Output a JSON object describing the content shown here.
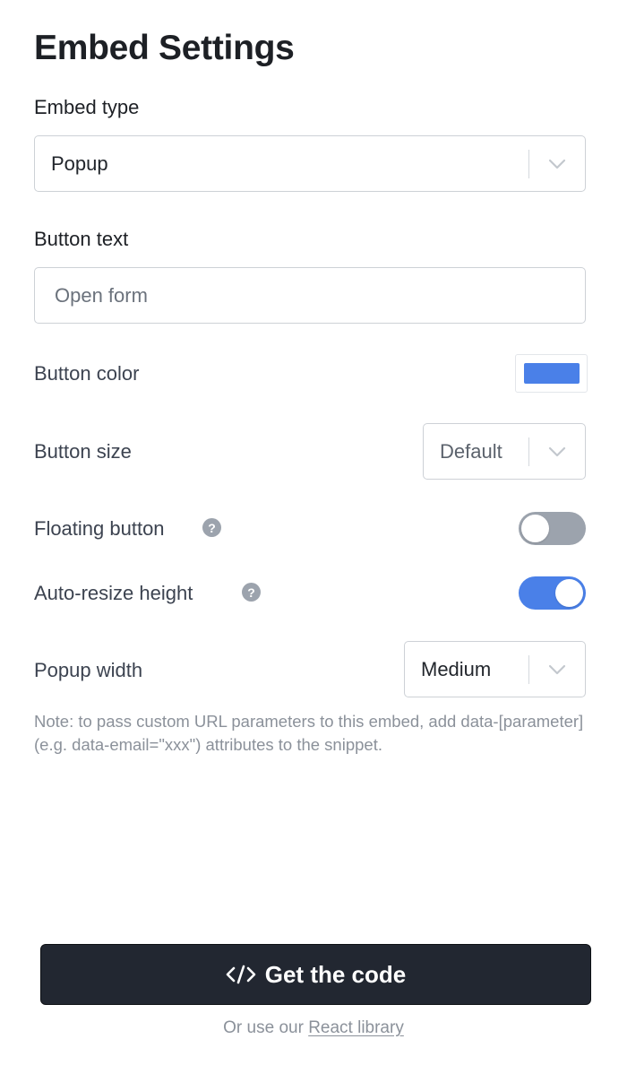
{
  "title": "Embed Settings",
  "embed_type": {
    "label": "Embed type",
    "value": "Popup"
  },
  "button_text": {
    "label": "Button text",
    "placeholder": "Open form"
  },
  "button_color": {
    "label": "Button color",
    "value": "#4a80e8"
  },
  "button_size": {
    "label": "Button size",
    "value": "Default"
  },
  "floating_button": {
    "label": "Floating button",
    "help": "?",
    "enabled": false
  },
  "auto_resize": {
    "label": "Auto-resize height",
    "help": "?",
    "enabled": true
  },
  "popup_width": {
    "label": "Popup width",
    "value": "Medium"
  },
  "note": "Note: to pass custom URL parameters to this embed, add data-[parameter] (e.g. data-email=\"xxx\") attributes to the snippet.",
  "cta": {
    "label": "Get the code",
    "icon": "code-icon"
  },
  "footer": {
    "prefix": "Or use our ",
    "link_label": "React library"
  },
  "colors": {
    "toggle_on": "#4a80e8",
    "toggle_off": "#9ca3ad",
    "cta_bg": "#222731"
  }
}
